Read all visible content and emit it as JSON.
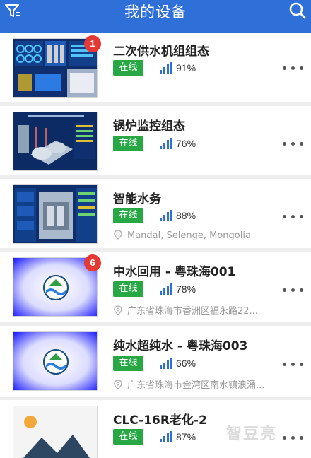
{
  "header": {
    "title": "我的设备",
    "filter_icon": "filter-icon",
    "search_icon": "search-icon"
  },
  "devices": [
    {
      "name": "二次供水机组组态",
      "status": "在线",
      "signal": "91%",
      "badge": "1",
      "location": ""
    },
    {
      "name": "锅炉监控组态",
      "status": "在线",
      "signal": "76%",
      "badge": "",
      "location": ""
    },
    {
      "name": "智能水务",
      "status": "在线",
      "signal": "88%",
      "badge": "",
      "location": "Mandal, Selenge, Mongolia"
    },
    {
      "name": "中水回用 - 粤珠海001",
      "status": "在线",
      "signal": "78%",
      "badge": "6",
      "location": "广东省珠海市香洲区福永路22..."
    },
    {
      "name": "纯水超纯水 - 粤珠海003",
      "status": "在线",
      "signal": "66%",
      "badge": "",
      "location": "广东省珠海市金湾区南水镇浪涌..."
    },
    {
      "name": "CLC-16R老化-2",
      "status": "在线",
      "signal": "87%",
      "badge": "",
      "location": ""
    }
  ],
  "colors": {
    "header_blue": "#2e6fd8",
    "status_green": "#28a745",
    "badge_red": "#e53935",
    "signal_blue": "#2e6fd8"
  },
  "watermark": "智豆亮"
}
